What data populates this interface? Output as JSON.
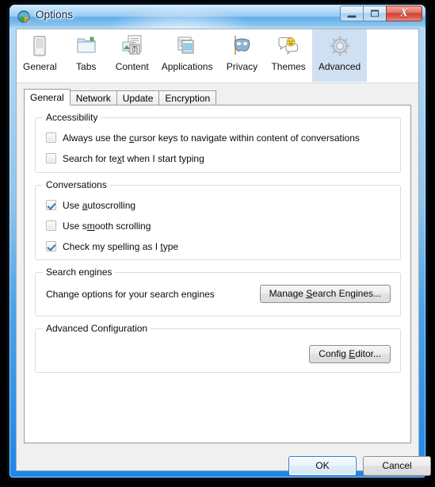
{
  "window": {
    "title": "Options",
    "icon": "globe-icon",
    "controls": {
      "minimize": "Minimize",
      "maximize": "Maximize",
      "close": "Close"
    }
  },
  "icon_tabs": {
    "selected": "Advanced",
    "items": [
      {
        "label": "General",
        "icon": "browser-window-icon"
      },
      {
        "label": "Tabs",
        "icon": "folder-tabs-icon"
      },
      {
        "label": "Content",
        "icon": "content-pages-icon"
      },
      {
        "label": "Applications",
        "icon": "applications-icon"
      },
      {
        "label": "Privacy",
        "icon": "mask-icon"
      },
      {
        "label": "Themes",
        "icon": "speech-bubble-smiley-icon"
      },
      {
        "label": "Advanced",
        "icon": "gear-icon"
      }
    ]
  },
  "sub_tabs": {
    "selected": "General",
    "items": [
      {
        "label": "General"
      },
      {
        "label": "Network"
      },
      {
        "label": "Update"
      },
      {
        "label": "Encryption"
      }
    ]
  },
  "groups": {
    "accessibility": {
      "caption": "Accessibility",
      "checkboxes": [
        {
          "label_pre": "Always use the ",
          "accel": "c",
          "label_post": "ursor keys to navigate within content of conversations",
          "checked": false
        },
        {
          "label_pre": "Search for te",
          "accel": "x",
          "label_post": "t when I start typing",
          "checked": false
        }
      ]
    },
    "conversations": {
      "caption": "Conversations",
      "checkboxes": [
        {
          "label_pre": "Use ",
          "accel": "a",
          "label_post": "utoscrolling",
          "checked": true
        },
        {
          "label_pre": "Use s",
          "accel": "m",
          "label_post": "ooth scrolling",
          "checked": false
        },
        {
          "label_pre": "Check my spelling as I ",
          "accel": "t",
          "label_post": "ype",
          "checked": true
        }
      ]
    },
    "search_engines": {
      "caption": "Search engines",
      "description": "Change options for your search engines",
      "button": {
        "label_pre": "Manage ",
        "accel": "S",
        "label_post": "earch Engines..."
      }
    },
    "advanced_configuration": {
      "caption": "Advanced Configuration",
      "button": {
        "label_pre": "Config ",
        "accel": "E",
        "label_post": "ditor..."
      }
    }
  },
  "footer": {
    "ok_label": "OK",
    "cancel_label": "Cancel"
  },
  "colors": {
    "frame_blue": "#1e86e8",
    "selected_tab": "#cfe0f2",
    "default_button_border": "#2f7fc9",
    "check_mark": "#3c72b9",
    "close_button_red": "#cd4334"
  }
}
